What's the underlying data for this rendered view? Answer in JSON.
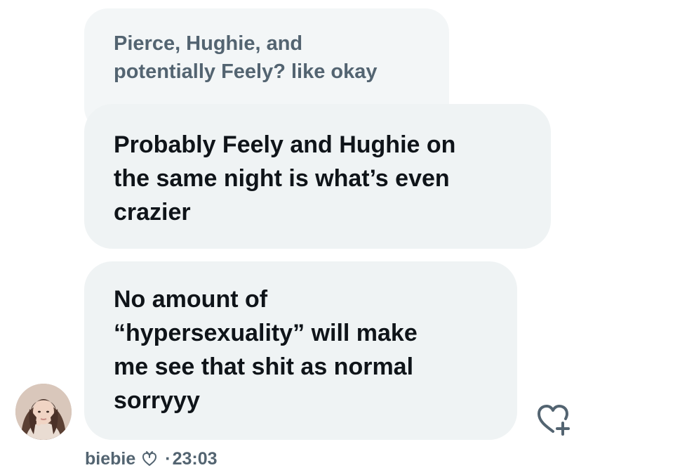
{
  "messages": {
    "quoted_text": "Pierce, Hughie, and\npotentially Feely? like okay",
    "message1_text": "Probably Feely and Hughie on\nthe same night is what’s even\ncrazier",
    "message2_text": "No amount of\n“hypersexuality” will make\nme see that shit as normal\nsorryyy"
  },
  "sender": {
    "name": "biebie",
    "name_emoji_icon": "heart-with-ribbon-icon",
    "separator": "·",
    "timestamp": "23:03",
    "avatar_icon": "profile-photo"
  },
  "actions": {
    "react_icon": "heart-plus-icon"
  },
  "colors": {
    "bubble_bg": "#eff3f4",
    "quoted_bubble_bg": "#f3f6f7",
    "primary_text": "#0f1419",
    "secondary_text": "#536471"
  }
}
